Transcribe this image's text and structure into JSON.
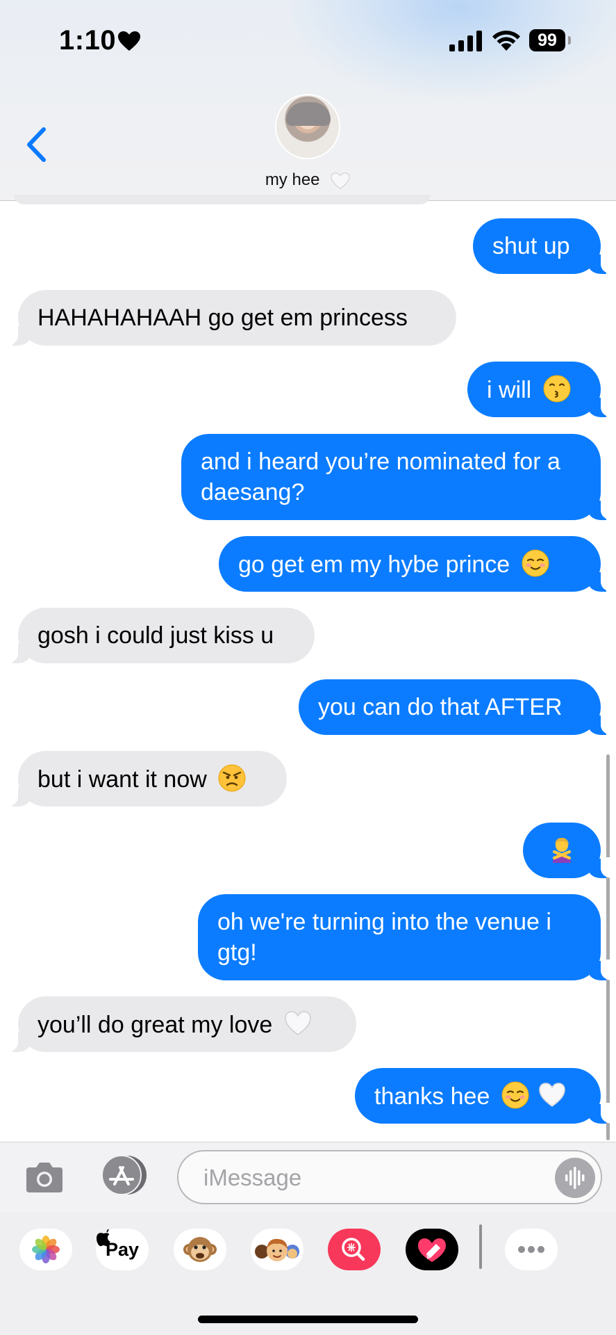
{
  "status_bar": {
    "time": "1:10",
    "battery": "99"
  },
  "header": {
    "contact_name": "my hee",
    "name_icon": "white-heart-icon",
    "back_icon": "chevron-left-icon"
  },
  "messages": [
    {
      "id": 1,
      "side": "sent",
      "text": "shut up",
      "emoji": []
    },
    {
      "id": 2,
      "side": "received",
      "text": "HAHAHAHAAH go get em princess",
      "emoji": []
    },
    {
      "id": 3,
      "side": "sent",
      "text": "i will",
      "emoji": [
        "kissing-face-icon"
      ]
    },
    {
      "id": 4,
      "side": "sent",
      "text": "and i heard you’re nominated for a daesang?",
      "emoji": []
    },
    {
      "id": 5,
      "side": "sent",
      "text": "go get em my hybe prince",
      "emoji": [
        "smiling-face-icon"
      ]
    },
    {
      "id": 6,
      "side": "received",
      "text": "gosh i could just kiss u",
      "emoji": []
    },
    {
      "id": 7,
      "side": "sent",
      "text": "you can do that AFTER",
      "emoji": []
    },
    {
      "id": 8,
      "side": "received",
      "text": "but i want it now",
      "emoji": [
        "angry-face-icon"
      ]
    },
    {
      "id": 9,
      "side": "sent",
      "text": "",
      "emoji": [
        "person-gesturing-no-icon"
      ]
    },
    {
      "id": 10,
      "side": "sent",
      "text": "oh we're turning into the venue i gtg!",
      "emoji": []
    },
    {
      "id": 11,
      "side": "received",
      "text": "you’ll do great my love",
      "emoji": [
        "white-heart-icon"
      ]
    },
    {
      "id": 12,
      "side": "sent",
      "text": "thanks hee",
      "emoji": [
        "smiling-face-icon",
        "white-heart-icon"
      ]
    }
  ],
  "input": {
    "placeholder": "iMessage",
    "value": ""
  },
  "apps": [
    {
      "name": "photos-icon"
    },
    {
      "name": "apple-pay-icon",
      "label": "Pay"
    },
    {
      "name": "monkey-icon"
    },
    {
      "name": "memoji-icon"
    },
    {
      "name": "images-search-icon"
    },
    {
      "name": "digital-touch-icon"
    },
    {
      "name": "more-icon"
    }
  ],
  "colors": {
    "sent_bubble": "#0b7cff",
    "received_bubble": "#e9e9eb",
    "accent": "#0a7aff"
  }
}
